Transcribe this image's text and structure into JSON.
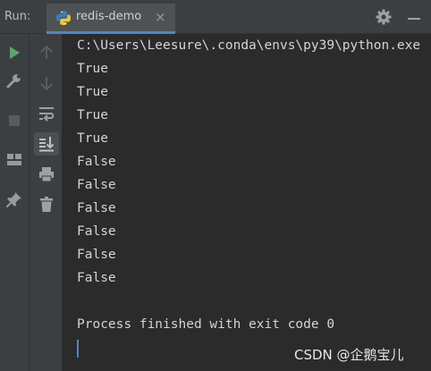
{
  "panel": {
    "run_label": "Run:",
    "tab_title": "redis-demo",
    "tab_close": "×"
  },
  "icons": {
    "tab": "python-icon",
    "top_right": [
      "gear-icon",
      "minimize-icon"
    ],
    "left_toolbar": [
      "run-icon",
      "wrench-icon",
      "stop-icon",
      "layout-icon",
      "pin-icon"
    ],
    "right_toolbar": [
      "up-arrow-icon",
      "down-arrow-icon",
      "soft-wrap-icon",
      "scroll-to-end-icon",
      "print-icon",
      "trash-icon"
    ]
  },
  "console": {
    "command": "C:\\Users\\Leesure\\.conda\\envs\\py39\\python.exe",
    "outputs": [
      "True",
      "True",
      "True",
      "True",
      "False",
      "False",
      "False",
      "False",
      "False",
      "False"
    ],
    "exit_message": "Process finished with exit code 0"
  },
  "watermark": "CSDN @企鹅宝儿",
  "colors": {
    "toolbar": "#3c3f41",
    "console_bg": "#2b2b2b",
    "text": "#d4d4d4",
    "accent": "#4a88c7",
    "run_green": "#59a869"
  }
}
